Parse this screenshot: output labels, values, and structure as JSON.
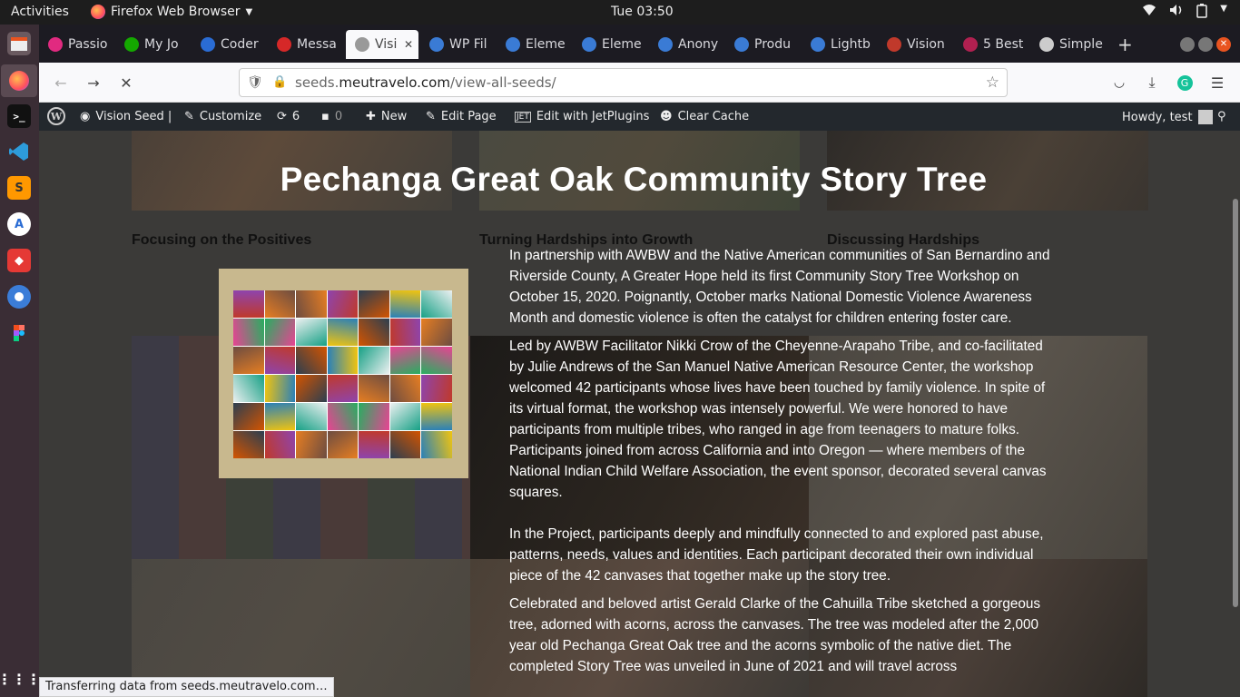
{
  "system": {
    "activities": "Activities",
    "app_name": "Firefox Web Browser",
    "clock": "Tue 03:50"
  },
  "tabs": [
    {
      "label": "Passio",
      "icon": "xd-icon",
      "color": "#e12a80"
    },
    {
      "label": "My Jo",
      "icon": "upwork-icon",
      "color": "#14a800"
    },
    {
      "label": "Coder",
      "icon": "codeable-icon",
      "color": "#2a6cd4"
    },
    {
      "label": "Messa",
      "icon": "messages-icon",
      "color": "#d62828"
    },
    {
      "label": "Visi",
      "icon": "loading-icon",
      "color": "#999999"
    },
    {
      "label": "WP Fil",
      "icon": "wordpress-icon",
      "color": "#3a7bd5"
    },
    {
      "label": "Eleme",
      "icon": "wordpress-icon",
      "color": "#3a7bd5"
    },
    {
      "label": "Eleme",
      "icon": "wordpress-icon",
      "color": "#3a7bd5"
    },
    {
      "label": "Anony",
      "icon": "wordpress-icon",
      "color": "#3a7bd5"
    },
    {
      "label": "Produ",
      "icon": "wordpress-icon",
      "color": "#3a7bd5"
    },
    {
      "label": "Lightb",
      "icon": "wordpress-icon",
      "color": "#3a7bd5"
    },
    {
      "label": "Vision",
      "icon": "awbw-icon",
      "color": "#c0392b"
    },
    {
      "label": "5 Best",
      "icon": "best-icon",
      "color": "#b02050"
    },
    {
      "label": "Simple",
      "icon": "wordpress-icon",
      "color": "#cccccc"
    }
  ],
  "url": {
    "prefix": "seeds.",
    "domain": "meutravelo.com",
    "path": "/view-all-seeds/"
  },
  "wpbar": {
    "site": "Vision Seed |",
    "customize": "Customize",
    "updates": "6",
    "comments": "0",
    "new": "New",
    "edit_page": "Edit Page",
    "edit_jet": "Edit with JetPlugins",
    "clear_cache": "Clear Cache",
    "howdy": "Howdy, test"
  },
  "page": {
    "title": "Pechanga Great Oak Community Story Tree",
    "col1": "Focusing on the Positives",
    "col2": "Turning Hardships into Growth",
    "col3": "Discussing Hardships",
    "paragraphs": [
      "In partnership with AWBW and the Native American communities of San Bernardino and Riverside County, A Greater Hope held its first Community Story Tree Workshop on October 15, 2020.  Poignantly, October marks National Domestic Violence Awareness Month and domestic violence is often the catalyst for children entering foster care.",
      "Led by AWBW Facilitator Nikki Crow of the Cheyenne-Arapaho Tribe, and co-facilitated by Julie Andrews of the San Manuel Native American Resource Center, the workshop welcomed 42 participants whose lives have been touched by family violence.  In spite of its virtual format, the workshop was intensely powerful.  We were honored to have participants from multiple tribes, who ranged in age from teenagers to mature folks.  Participants joined from across California and into Oregon — where members of the National Indian Child Welfare Association, the event sponsor, decorated several canvas squares.",
      "In the Project, participants deeply and mindfully connected to and explored past abuse, patterns, needs, values and identities.   Each participant decorated their own individual piece of the 42 canvases that together make up the story tree.",
      "Celebrated and beloved artist Gerald Clarke of the Cahuilla Tribe sketched a gorgeous tree, adorned with acorns, across the canvases.  The tree was modeled after the 2,000 year old Pechanga Great Oak tree and the acorns symbolic of the native diet.  The completed Story Tree was unveiled in June of 2021 and will travel across"
    ]
  },
  "status": "Transferring data from seeds.meutravelo.com…"
}
